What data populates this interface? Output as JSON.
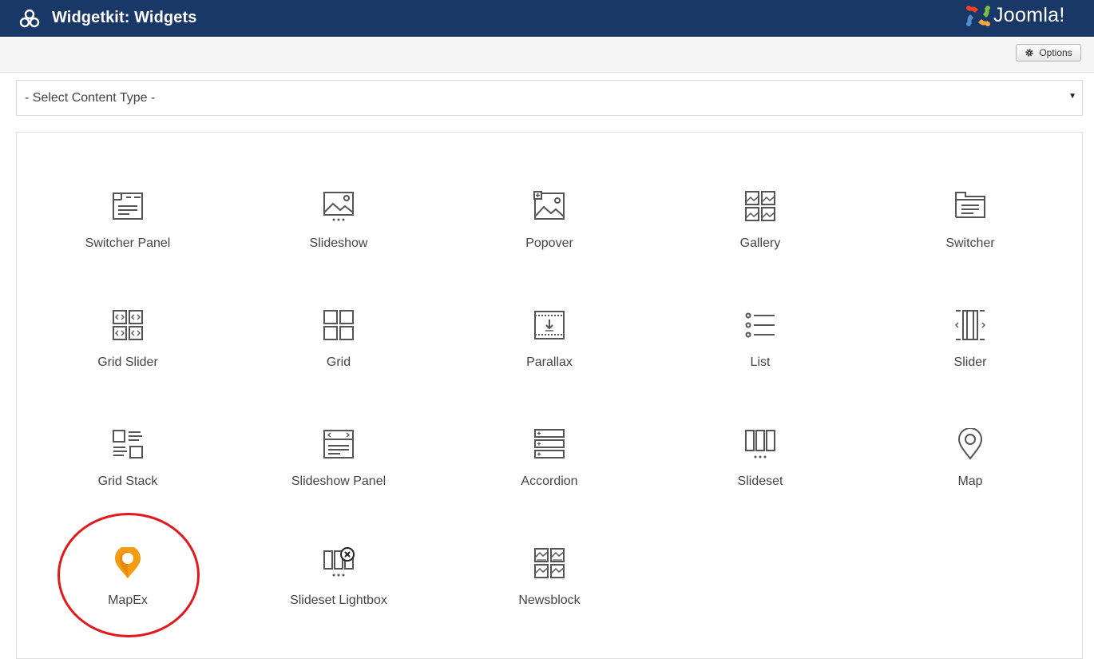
{
  "header": {
    "title": "Widgetkit: Widgets",
    "brand": "Joomla!",
    "background_color": "#1a3867"
  },
  "toolbar": {
    "options_label": "Options",
    "options_icon": "gear-icon"
  },
  "content_type_select": {
    "selected": "- Select Content Type -"
  },
  "widgets": [
    {
      "label": "Switcher Panel",
      "icon": "switcher-panel-icon"
    },
    {
      "label": "Slideshow",
      "icon": "slideshow-icon"
    },
    {
      "label": "Popover",
      "icon": "popover-icon"
    },
    {
      "label": "Gallery",
      "icon": "gallery-icon"
    },
    {
      "label": "Switcher",
      "icon": "switcher-icon"
    },
    {
      "label": "Grid Slider",
      "icon": "grid-slider-icon"
    },
    {
      "label": "Grid",
      "icon": "grid-icon"
    },
    {
      "label": "Parallax",
      "icon": "parallax-icon"
    },
    {
      "label": "List",
      "icon": "list-icon"
    },
    {
      "label": "Slider",
      "icon": "slider-icon"
    },
    {
      "label": "Grid Stack",
      "icon": "grid-stack-icon"
    },
    {
      "label": "Slideshow Panel",
      "icon": "slideshow-panel-icon"
    },
    {
      "label": "Accordion",
      "icon": "accordion-icon"
    },
    {
      "label": "Slideset",
      "icon": "slideset-icon"
    },
    {
      "label": "Map",
      "icon": "map-pin-icon"
    },
    {
      "label": "MapEx",
      "icon": "map-pin-orange-icon",
      "highlighted": true,
      "accent_color": "#f39c12"
    },
    {
      "label": "Slideset Lightbox",
      "icon": "slideset-lightbox-icon"
    },
    {
      "label": "Newsblock",
      "icon": "newsblock-icon"
    }
  ],
  "annotation_color": "#e2191c"
}
